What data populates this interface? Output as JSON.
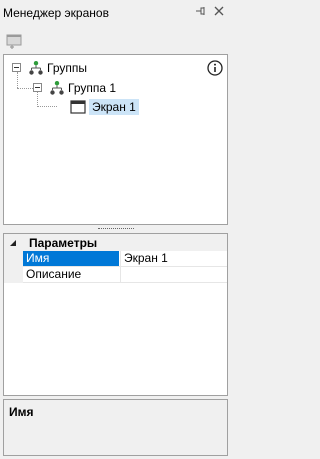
{
  "window": {
    "title": "Менеджер экранов",
    "pin_icon": "pin-icon",
    "close_icon": "close-icon"
  },
  "toolbar": {
    "add_icon": "add-screen-icon"
  },
  "tree": {
    "root": {
      "label": "Группы",
      "icon": "groups-icon",
      "expanded": true
    },
    "group": {
      "label": "Группа 1",
      "icon": "group-icon",
      "expanded": true
    },
    "screen": {
      "label": "Экран 1",
      "icon": "screen-icon",
      "selected": true
    },
    "info_icon": "info-icon"
  },
  "properties": {
    "category": "Параметры",
    "rows": [
      {
        "name": "Имя",
        "value": "Экран 1",
        "selected": true
      },
      {
        "name": "Описание",
        "value": ""
      }
    ]
  },
  "description": {
    "title": "Имя"
  },
  "colors": {
    "selection": "#0078d7",
    "tree_selection": "#cce4f7",
    "background": "#f0f0f0"
  }
}
